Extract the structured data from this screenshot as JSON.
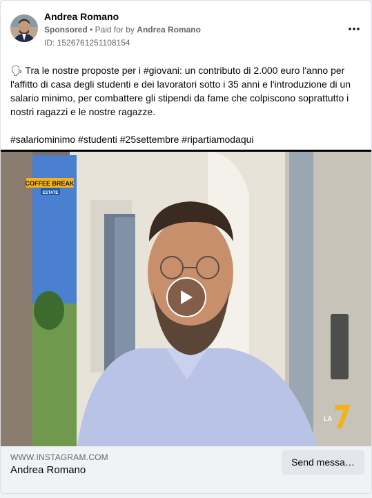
{
  "post": {
    "author": "Andrea Romano",
    "sponsored": "Sponsored",
    "separator": "•",
    "paid_for_prefix": "Paid for by",
    "paid_for_name": "Andrea Romano",
    "ad_id": "ID: 1526761251108154",
    "more_icon": "more-horizontal-icon",
    "text_line1": "🗣 Tra le nostre proposte per i #giovani: un contributo di 2.000 euro l'anno per l'affitto di casa degli studenti e dei lavoratori sotto i 35 anni e l'introduzione di un salario minimo, per combattere gli stipendi da fame che colpiscono soprattutto i nostri ragazzi e le nostre ragazze.",
    "hashtags": "#salariominimo #studenti #25settembre #ripartiamodaqui"
  },
  "video": {
    "overlay_brand": "COFFEE BREAK",
    "overlay_sub": "ESTATE",
    "channel_logo": "LA 7",
    "play_icon": "play-icon"
  },
  "footer": {
    "domain": "WWW.INSTAGRAM.COM",
    "title": "Andrea Romano",
    "cta_label": "Send messa…"
  }
}
